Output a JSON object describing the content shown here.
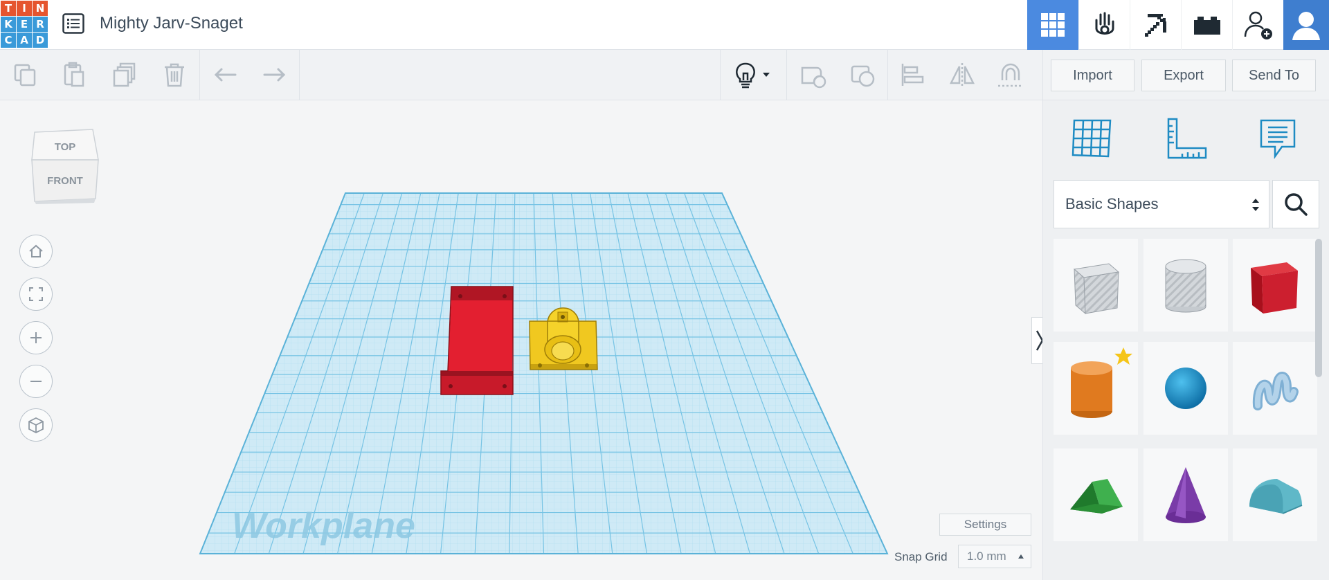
{
  "app": {
    "logo_letters": [
      "T",
      "I",
      "N",
      "K",
      "E",
      "R",
      "C",
      "A",
      "D"
    ],
    "logo_colors": [
      "#e5552f",
      "#e5552f",
      "#e5552f",
      "#3a9ad9",
      "#3a9ad9",
      "#3a9ad9",
      "#3a9ad9",
      "#3a9ad9",
      "#3a9ad9"
    ],
    "design_title": "Mighty Jarv-Snaget"
  },
  "top_nav": {
    "icons": [
      "grid-view-icon",
      "sim-lab-icon",
      "minecraft-pickaxe-icon",
      "bricks-icon",
      "invite-user-icon",
      "user-avatar"
    ]
  },
  "toolbar": {
    "icons": [
      "copy-icon",
      "paste-icon",
      "duplicate-icon",
      "delete-icon",
      "undo-icon",
      "redo-icon",
      "lightbulb-icon",
      "group-icon",
      "ungroup-icon",
      "align-icon",
      "mirror-icon",
      "cruise-icon"
    ],
    "import_label": "Import",
    "export_label": "Export",
    "send_to_label": "Send To"
  },
  "viewcube": {
    "top_label": "TOP",
    "front_label": "FRONT"
  },
  "view_controls": [
    "home-view-icon",
    "fit-view-icon",
    "zoom-in-icon",
    "zoom-out-icon",
    "perspective-icon"
  ],
  "workplane": {
    "label": "Workplane",
    "grid_color": "#7fc8e8"
  },
  "canvas_controls": {
    "settings_label": "Settings",
    "snap_grid_label": "Snap Grid",
    "snap_grid_value": "1.0 mm"
  },
  "shapes_panel": {
    "top_icons": [
      "workplane-grid-icon",
      "ruler-icon",
      "notes-icon"
    ],
    "category": "Basic Shapes",
    "shapes": [
      {
        "name": "box-hole",
        "color": "#c8ccd0"
      },
      {
        "name": "cylinder-hole",
        "color": "#c8ccd0"
      },
      {
        "name": "box",
        "color": "#cc1f2f"
      },
      {
        "name": "cylinder",
        "color": "#e07a1f"
      },
      {
        "name": "sphere",
        "color": "#1f90c8"
      },
      {
        "name": "scribble",
        "color": "#9cc4e0"
      },
      {
        "name": "roof",
        "color": "#2e9e3c"
      },
      {
        "name": "cone",
        "color": "#7a3ca8"
      },
      {
        "name": "round-roof",
        "color": "#5fb8c8"
      }
    ]
  },
  "colors": {
    "accent": "#4b8ae0",
    "object_red": "#e31f30",
    "object_yellow": "#f0c820"
  }
}
